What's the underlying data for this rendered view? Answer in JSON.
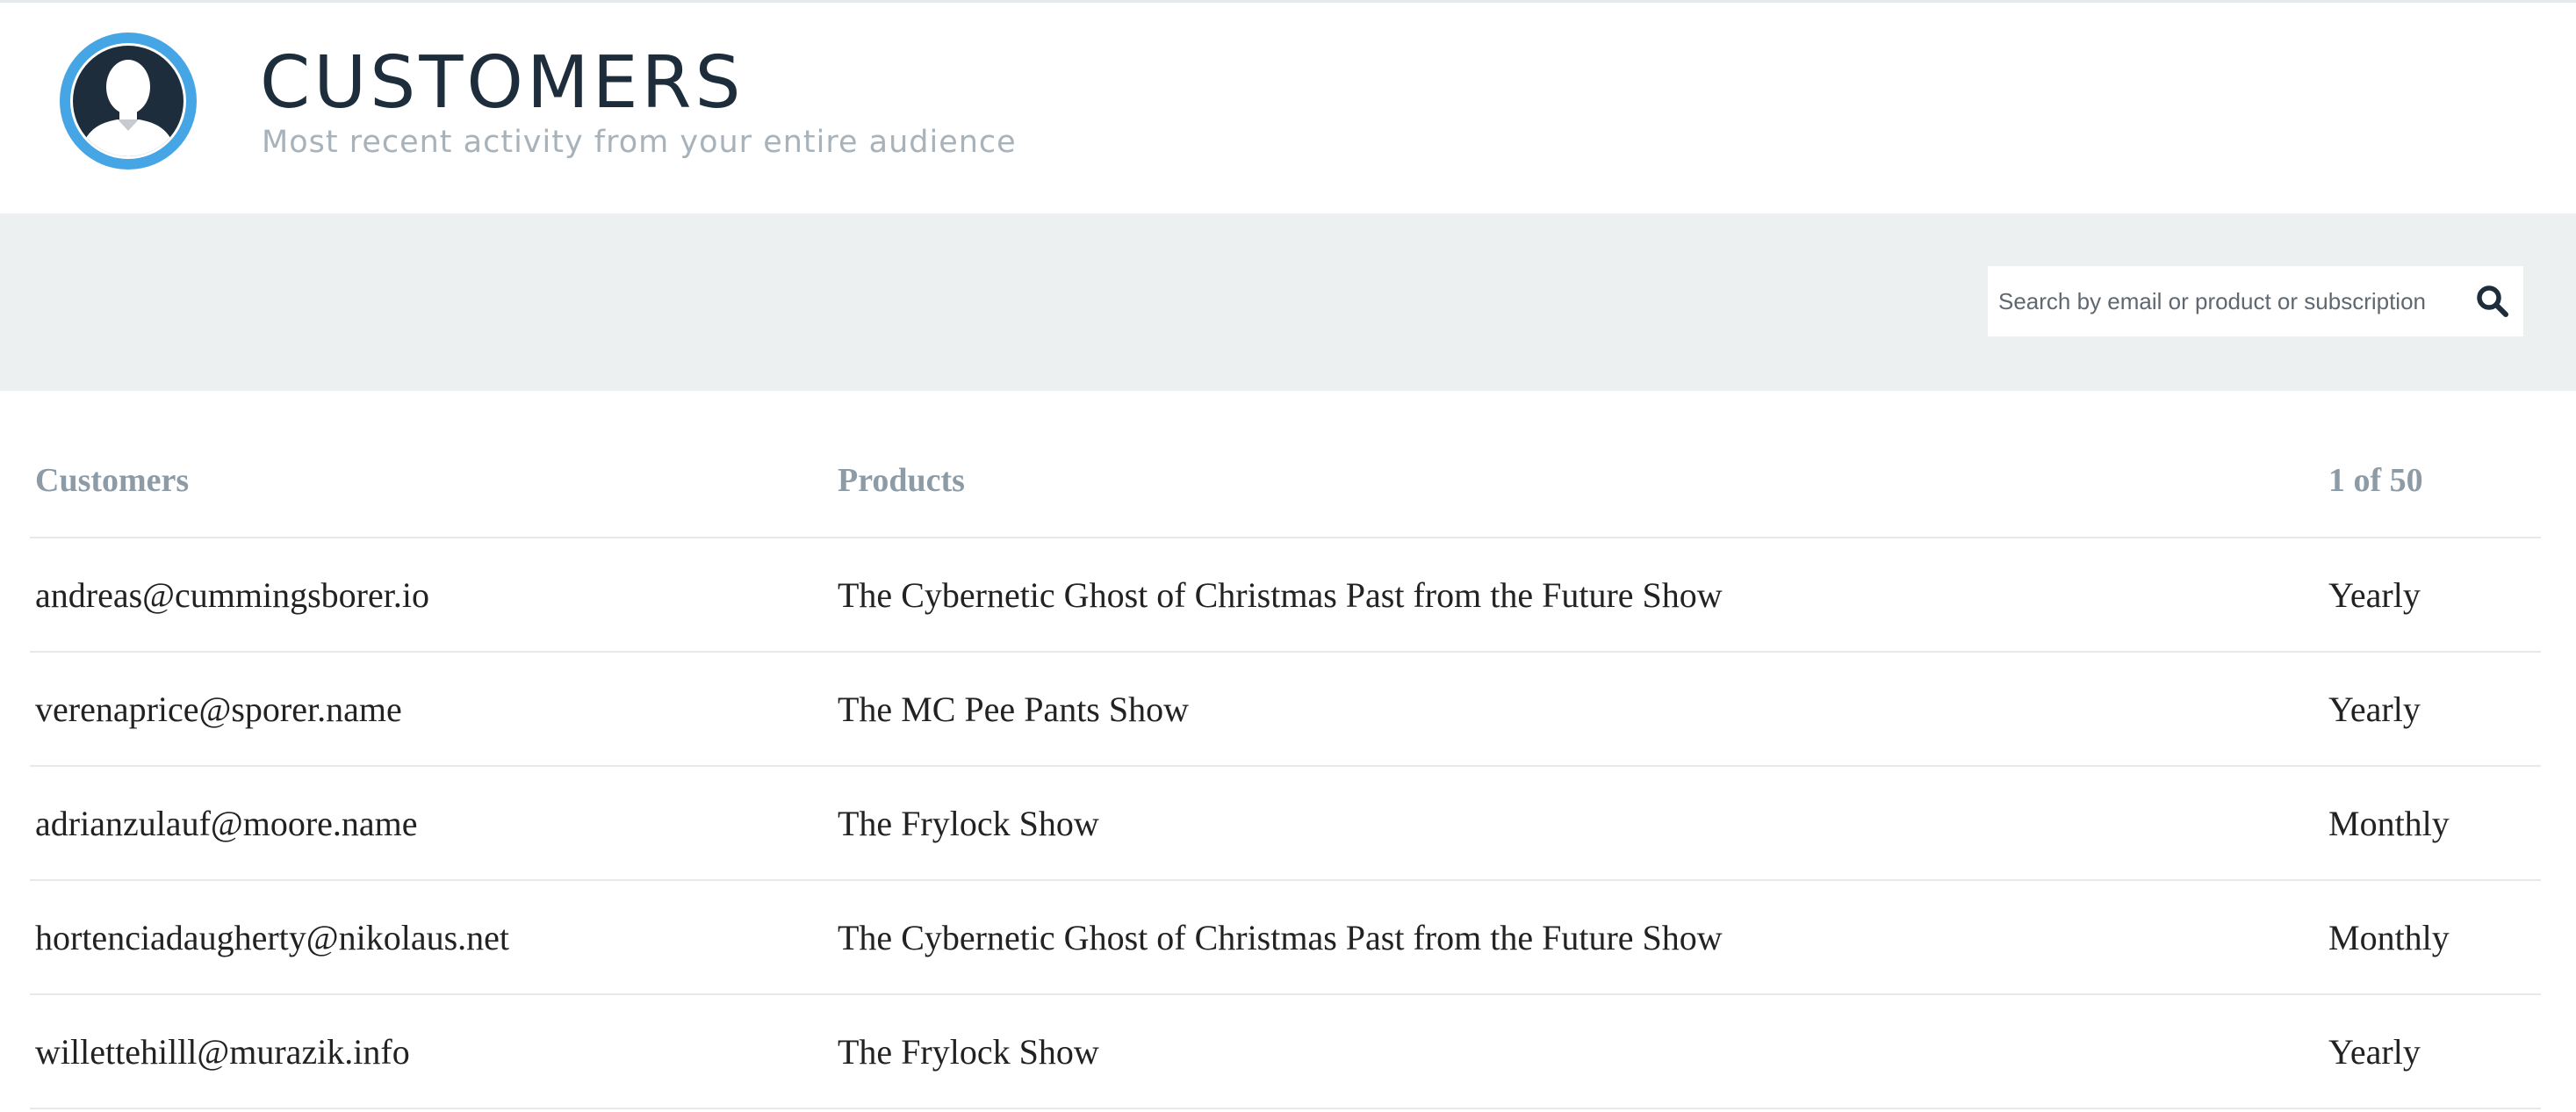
{
  "header": {
    "title": "CUSTOMERS",
    "subtitle": "Most recent activity from your entire audience"
  },
  "search": {
    "placeholder": "Search by email or product or subscription",
    "value": ""
  },
  "table": {
    "columns": {
      "customers": "Customers",
      "products": "Products",
      "pagination": "1 of 50"
    },
    "rows": [
      {
        "email": "andreas@cummingsborer.io",
        "product": "The Cybernetic Ghost of Christmas Past from the Future Show",
        "plan": "Yearly"
      },
      {
        "email": "verenaprice@sporer.name",
        "product": "The MC Pee Pants Show",
        "plan": "Yearly"
      },
      {
        "email": "adrianzulauf@moore.name",
        "product": "The Frylock Show",
        "plan": "Monthly"
      },
      {
        "email": "hortenciadaugherty@nikolaus.net",
        "product": "The Cybernetic Ghost of Christmas Past from the Future Show",
        "plan": "Monthly"
      },
      {
        "email": "willettehilll@murazik.info",
        "product": "The Frylock Show",
        "plan": "Yearly"
      }
    ]
  },
  "icons": {
    "avatar": "user-avatar-icon",
    "search": "search-icon"
  },
  "colors": {
    "accent": "#46a5e5",
    "dark": "#1e2d3b",
    "muted": "#a7b2bb",
    "band": "#edf0f1"
  }
}
